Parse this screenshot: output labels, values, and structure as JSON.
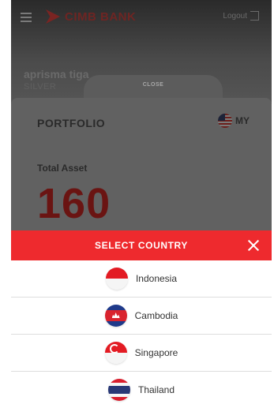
{
  "app": {
    "brand": "CIMB BANK",
    "logout_label": "Logout",
    "user_name": "aprisma tiga",
    "user_subtitle": "SILVER",
    "close_label": "CLOSE"
  },
  "portfolio": {
    "title": "PORTFOLIO",
    "country_code": "MY",
    "total_asset_label": "Total Asset",
    "total_asset_value": "160"
  },
  "country_sheet": {
    "title": "SELECT COUNTRY",
    "countries": [
      {
        "name": "Indonesia",
        "flag": "flag-indonesia-icon"
      },
      {
        "name": "Cambodia",
        "flag": "flag-cambodia-icon"
      },
      {
        "name": "Singapore",
        "flag": "flag-singapore-icon"
      },
      {
        "name": "Thailand",
        "flag": "flag-thailand-icon"
      }
    ]
  },
  "colors": {
    "accent_red": "#ee2a2e",
    "overlay": "#3a3a3a"
  }
}
